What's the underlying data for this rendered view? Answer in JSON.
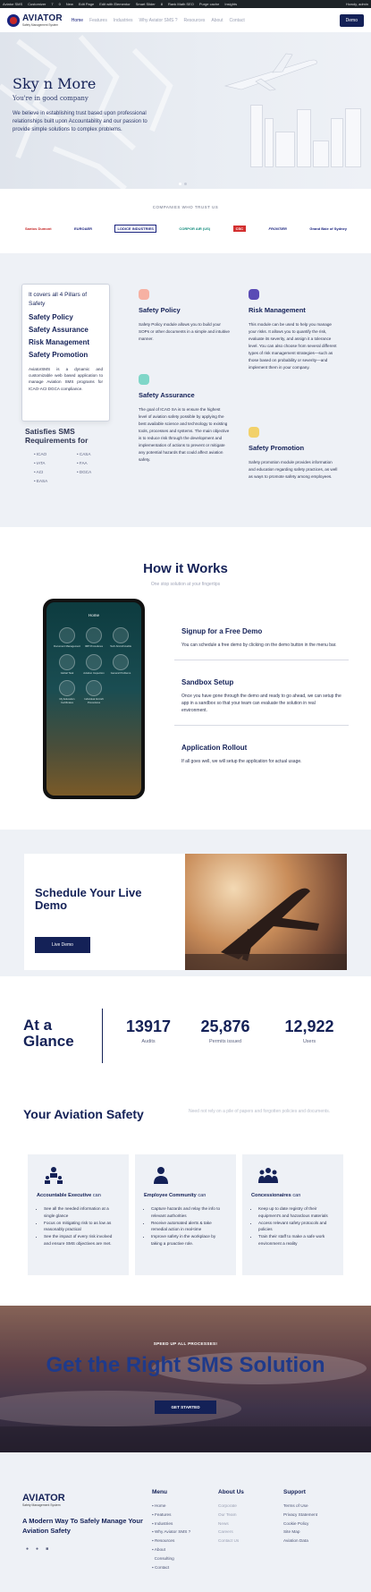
{
  "admin_bar": {
    "items": [
      "Aviator SMS",
      "Customizer",
      "7",
      "0",
      "New",
      "Edit Page",
      "Edit with Elementor",
      "Smart Slider",
      "8",
      "Rank Math SEO",
      "Purge cache",
      "Insights"
    ],
    "right": "Howdy, admin"
  },
  "header": {
    "logo_text": "AVIATOR",
    "logo_sub": "Safety Management System",
    "nav": [
      "Home",
      "Features",
      "Industries",
      "Why Aviator SMS ?",
      "Resources",
      "About",
      "Contact"
    ],
    "demo_label": "Demo"
  },
  "hero": {
    "title": "Sky n More",
    "subtitle": "You're in good company",
    "text": "We believe in establishing trust based upon professional relationships built upon Accountability and our passion to provide simple solutions to complex problems."
  },
  "trusted": {
    "label": "COMPANIES WHO TRUST US",
    "logos": [
      "Santos Dumont",
      "EUROAER",
      "LODICE INDUSTRIES",
      "CORPOR AIR (US)",
      "CSC",
      "FRONTIER",
      "Grand Baie of Sydney"
    ]
  },
  "pillars": {
    "card_heading": "It covers all 4 Pillars of Safety",
    "items": [
      "Safety Policy",
      "Safety Assurance",
      "Risk Management",
      "Safety Promotion"
    ],
    "card_desc": "AviatorSMS is a dynamic and customizable web based application to manage Aviation SMS programs for ICAO-ACI DGCA compliance.",
    "satisfies": "Satisfies SMS Requirements for",
    "requirements": [
      "ICAO",
      "CASA",
      "IATA",
      "FAA",
      "ACI",
      "DGCA",
      "EASA"
    ]
  },
  "features": [
    {
      "title": "Safety Policy",
      "text": "Safety Policy module allows you to build your SOPs or other documents in a simple and intuitive manner."
    },
    {
      "title": "Risk Management",
      "text": "This module can be used to help you manage your risks. It allows you to quantify the risk, evaluate its severity, and assign it a tolerance level. You can also choose from several different types of risk management strategies—such as those based on probability or severity—and implement them in your company."
    },
    {
      "title": "Safety Assurance",
      "text": "The goal of ICAO SA is to ensure the highest level of aviation safety possible by applying the best available science and technology to existing tools, processes and systems. The main objective is to reduce risk through the development and implementation of actions to prevent or mitigate any potential hazards that could affect aviation safety."
    },
    {
      "title": "Safety Promotion",
      "text": "Safety promotion module provides information and education regarding safety practices, as well as ways to promote safety among employees."
    }
  ],
  "how": {
    "title": "How it Works",
    "subtitle": "One stop solution at your fingertips",
    "phone_title": "Home",
    "phone_tiles": [
      "Document Management",
      "IMP Procedures",
      "Tech Aircraft Audits",
      "Global Task",
      "Aviation Inspection",
      "General Problems",
      "My Education Certificates",
      "Individual Aircraft Procedures"
    ],
    "steps": [
      {
        "title": "Signup for a Free Demo",
        "text": "You can schedule a free demo by clicking on the demo button in the menu bar."
      },
      {
        "title": "Sandbox Setup",
        "text": "Once you have gone through the demo and ready to go ahead, we can setup the app in a sandbox so that your team can evaluate the solution in real environment."
      },
      {
        "title": "Application Rollout",
        "text": "If all goes well, we will setup the application for actual usage."
      }
    ]
  },
  "schedule": {
    "title": "Schedule Your Live Demo",
    "button": "Live Demo"
  },
  "glance": {
    "title": "At a Glance",
    "stats": [
      {
        "value": "13917",
        "label": "Audits"
      },
      {
        "value": "25,876",
        "label": "Permits issued"
      },
      {
        "value": "12,922",
        "label": "Users"
      }
    ]
  },
  "safety": {
    "title": "Your Aviation Safety",
    "text": "Need not rely on a pile of papers and forgotten policies and documents.",
    "columns": [
      {
        "title": "Accountable Executive",
        "suffix": "can",
        "items": [
          "See all the needed information at a single glance",
          "Focus on mitigating risk to as low as reasonably practical",
          "See the impact of every risk involved and ensure SMS objectives are met."
        ]
      },
      {
        "title": "Employee Community",
        "suffix": "can",
        "items": [
          "Capture hazards and relay the info to relevant authorities",
          "Receive automated alerts & take remedial action in real-time",
          "Improve safety in the workplace by taking a proactive role."
        ]
      },
      {
        "title": "Concessionaires",
        "suffix": "can",
        "items": [
          "Keep up to date registry of their equipment's and hazardous materials",
          "Access relevant safety protocols and policies",
          "Train their staff to make a safe work environment a reality"
        ]
      }
    ]
  },
  "cta": {
    "kicker": "SPEED UP ALL PROCESSES!",
    "title": "Get the Right SMS Solution",
    "button": "GET STARTED"
  },
  "footer": {
    "logo_text": "AVIATOR",
    "logo_sub": "Safety Management System",
    "tagline": "A Modern Way To Safely Manage Your Aviation Safety",
    "menu_title": "Menu",
    "menu": [
      "Home",
      "Features",
      "Industries",
      "Why Aviator SMS ?",
      "Resources",
      "About",
      "Consulting",
      "Contact"
    ],
    "about_title": "About Us",
    "about": [
      "Corporate",
      "Our Team",
      "News",
      "Careers",
      "Contact Us"
    ],
    "support_title": "Support",
    "support": [
      "Terms of Use",
      "Privacy Statement",
      "Cookie Policy",
      "Site Map",
      "Aviation Data"
    ]
  },
  "colors": {
    "primary": "#142157",
    "bg_light": "#eef1f6",
    "accent_red": "#c62828"
  }
}
